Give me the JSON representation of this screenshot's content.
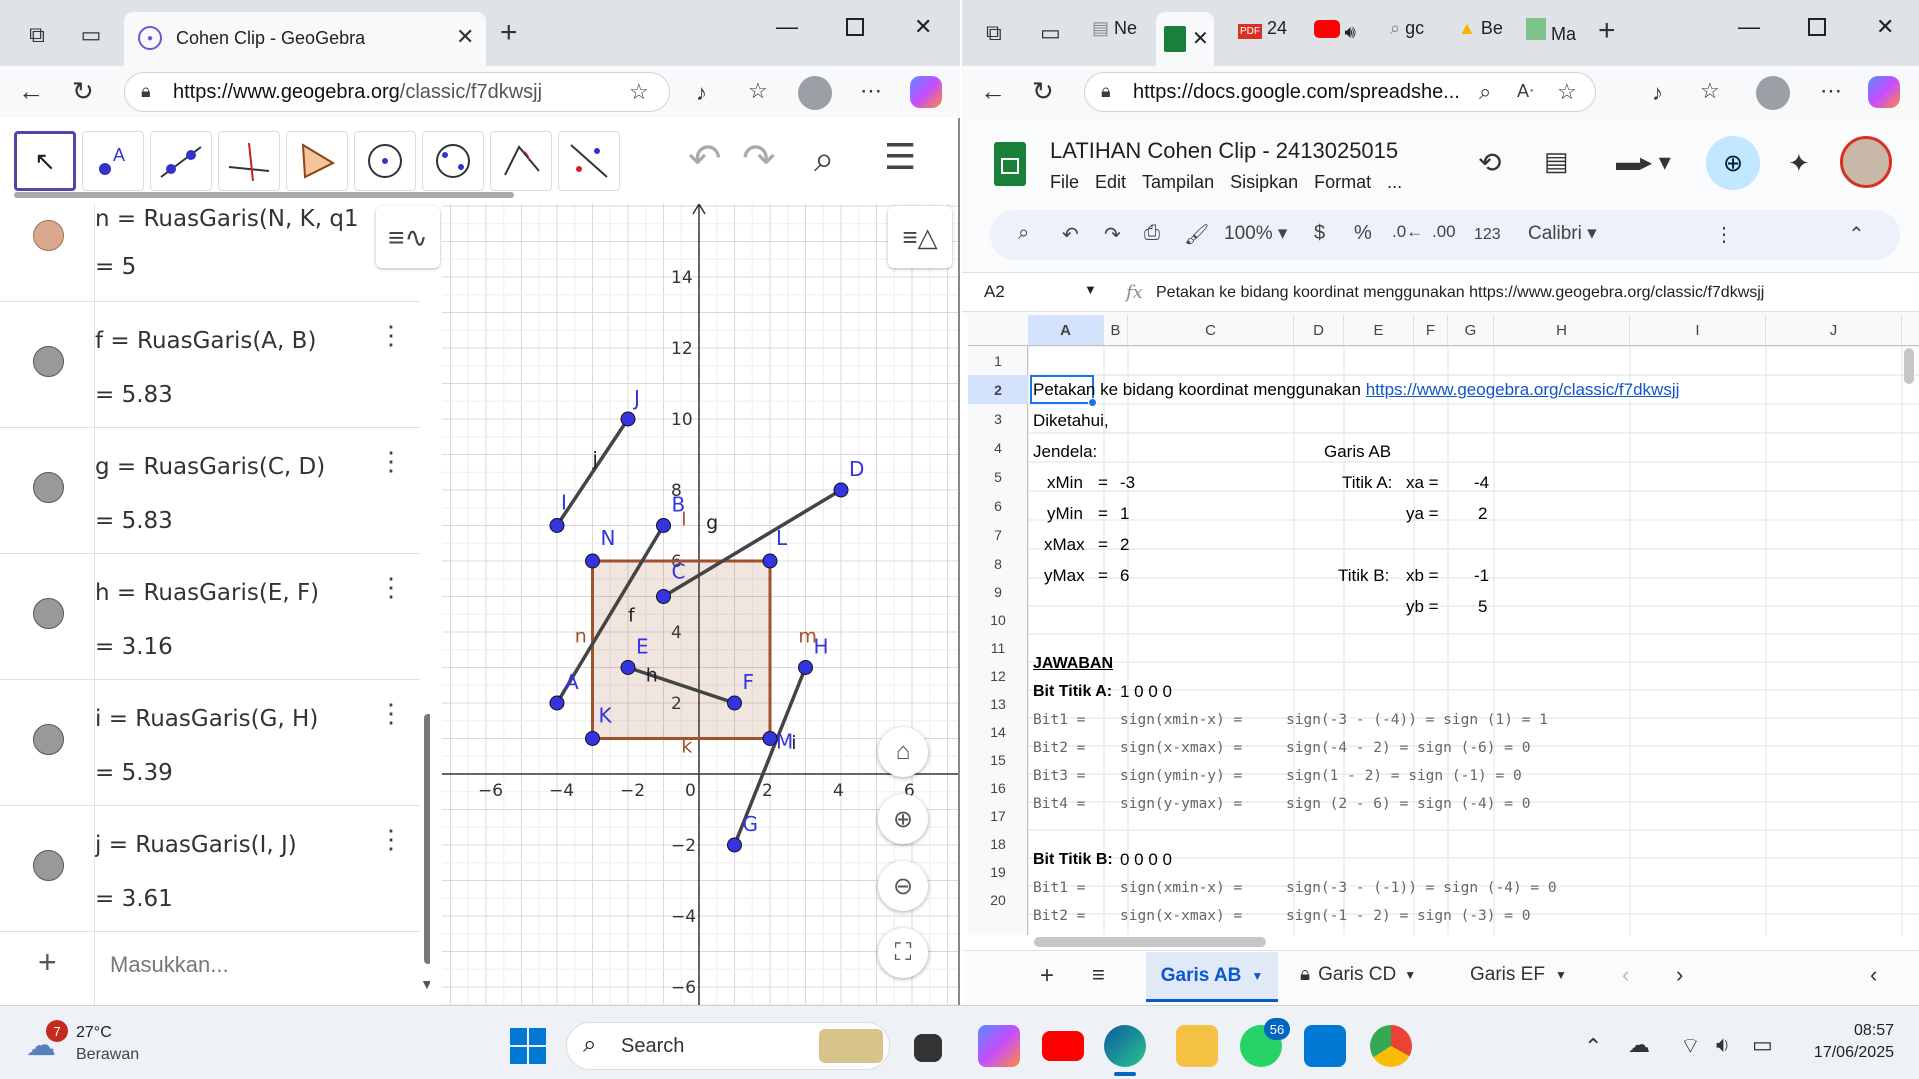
{
  "left_window": {
    "tab_title": "Cohen Clip - GeoGebra",
    "url_host": "https://www.geogebra.org",
    "url_path": "/classic/f7dkwsjj",
    "algebra": [
      {
        "def": "n = RuasGaris(N, K, q1",
        "val": "= 5",
        "color": "#d8a890"
      },
      {
        "def": "f = RuasGaris(A, B)",
        "val": "= 5.83",
        "color": "#999999"
      },
      {
        "def": "g = RuasGaris(C, D)",
        "val": "= 5.83",
        "color": "#999999"
      },
      {
        "def": "h = RuasGaris(E, F)",
        "val": "= 3.16",
        "color": "#999999"
      },
      {
        "def": "i = RuasGaris(G, H)",
        "val": "= 5.39",
        "color": "#999999"
      },
      {
        "def": "j = RuasGaris(I, J)",
        "val": "= 3.61",
        "color": "#999999"
      }
    ],
    "input_placeholder": "Masukkan...",
    "add_symbol": "+",
    "graph": {
      "x_ticks": [
        "−6",
        "−4",
        "−2",
        "0",
        "2",
        "4",
        "6"
      ],
      "y_ticks": [
        "14",
        "12",
        "10",
        "8",
        "6",
        "4",
        "2",
        "−2",
        "−4",
        "−6"
      ],
      "points": [
        {
          "label": "A",
          "x": -4,
          "y": 2
        },
        {
          "label": "B",
          "x": -1,
          "y": 7
        },
        {
          "label": "C",
          "x": -1,
          "y": 5
        },
        {
          "label": "D",
          "x": 4,
          "y": 8
        },
        {
          "label": "E",
          "x": -2,
          "y": 3
        },
        {
          "label": "F",
          "x": 1,
          "y": 2
        },
        {
          "label": "G",
          "x": 1,
          "y": -2
        },
        {
          "label": "H",
          "x": 3,
          "y": 3
        },
        {
          "label": "I",
          "x": -4,
          "y": 7
        },
        {
          "label": "J",
          "x": -2,
          "y": 10
        },
        {
          "label": "K",
          "x": -3,
          "y": 1
        },
        {
          "label": "L",
          "x": 2,
          "y": 6
        },
        {
          "label": "N",
          "x": -3,
          "y": 6
        },
        {
          "label": "",
          "x": 2,
          "y": 1
        }
      ],
      "segment_labels": [
        "f",
        "g",
        "h",
        "i",
        "j",
        "n",
        "k",
        "l",
        "m"
      ],
      "window": {
        "xmin": -3,
        "ymin": 1,
        "xmax": 2,
        "ymax": 6
      }
    }
  },
  "right_window": {
    "tabs": [
      "Ne",
      "24",
      "gc",
      "Be",
      "Ma"
    ],
    "url": "https://docs.google.com/spreadshe...",
    "doc_title": "LATIHAN Cohen Clip - 2413025015",
    "menu": [
      "File",
      "Edit",
      "Tampilan",
      "Sisipkan",
      "Format",
      "..."
    ],
    "zoom": "100%",
    "font": "Calibri",
    "fmt_num": "123",
    "cell_ref": "A2",
    "formula": "Petakan ke bidang koordinat menggunakan https://www.geogebra.org/classic/f7dkwsjj",
    "columns": [
      "A",
      "B",
      "C",
      "D",
      "E",
      "F",
      "G",
      "H",
      "I",
      "J"
    ],
    "rows": [
      "1",
      "2",
      "3",
      "4",
      "5",
      "6",
      "7",
      "8",
      "9",
      "10",
      "11",
      "12",
      "13",
      "14",
      "15",
      "16",
      "17",
      "18",
      "19",
      "20"
    ],
    "cells": {
      "r2a": "Petakan ke bidang koordinat menggunakan ",
      "r2link": "https://www.geogebra.org/classic/f7dkwsjj",
      "r3": "Diketahui,",
      "r4a": "Jendela:",
      "r4e": "Garis  AB",
      "r5a": "xMin",
      "r5b": "=",
      "r5c": "-3",
      "r5e": "Titik A:",
      "r5f": "xa =",
      "r5g": "-4",
      "r6a": "yMin",
      "r6b": "=",
      "r6c": "1",
      "r6f": "ya =",
      "r6g": "2",
      "r7a": "xMax",
      "r7b": "=",
      "r7c": "2",
      "r8a": "yMax",
      "r8b": "=",
      "r8c": "6",
      "r8e": "Titik B:",
      "r8f": "xb =",
      "r8g": "-1",
      "r9f": "yb =",
      "r9g": "5",
      "r11": "JAWABAN",
      "r12a": "Bit Titik A:",
      "r12c": "1 0 0 0",
      "r13a": "Bit1 =",
      "r13c": "sign(xmin-x) =",
      "r13d": "sign(-3 - (-4)) = sign (1) = 1",
      "r14a": "Bit2 =",
      "r14c": "sign(x-xmax) =",
      "r14d": "sign(-4 - 2) = sign (-6) = 0",
      "r15a": "Bit3 =",
      "r15c": "sign(ymin-y) =",
      "r15d": "sign(1 - 2) = sign (-1) = 0",
      "r16a": "Bit4 =",
      "r16c": "sign(y-ymax) =",
      "r16d": "sign (2 - 6) = sign (-4) = 0",
      "r18a": "Bit Titik B:",
      "r18c": "0 0 0 0",
      "r19a": "Bit1 =",
      "r19c": "sign(xmin-x) =",
      "r19d": "sign(-3 - (-1)) = sign (-4) = 0",
      "r20a": "Bit2 =",
      "r20c": "sign(x-xmax) =",
      "r20d": "sign(-1 - 2) = sign (-3) = 0"
    },
    "sheets": [
      "Garis AB",
      "Garis CD",
      "Garis EF"
    ]
  },
  "taskbar": {
    "temp": "27°C",
    "weather": "Berawan",
    "weather_badge": "7",
    "search": "Search",
    "whatsapp_badge": "56",
    "time": "08:57",
    "date": "17/06/2025"
  }
}
